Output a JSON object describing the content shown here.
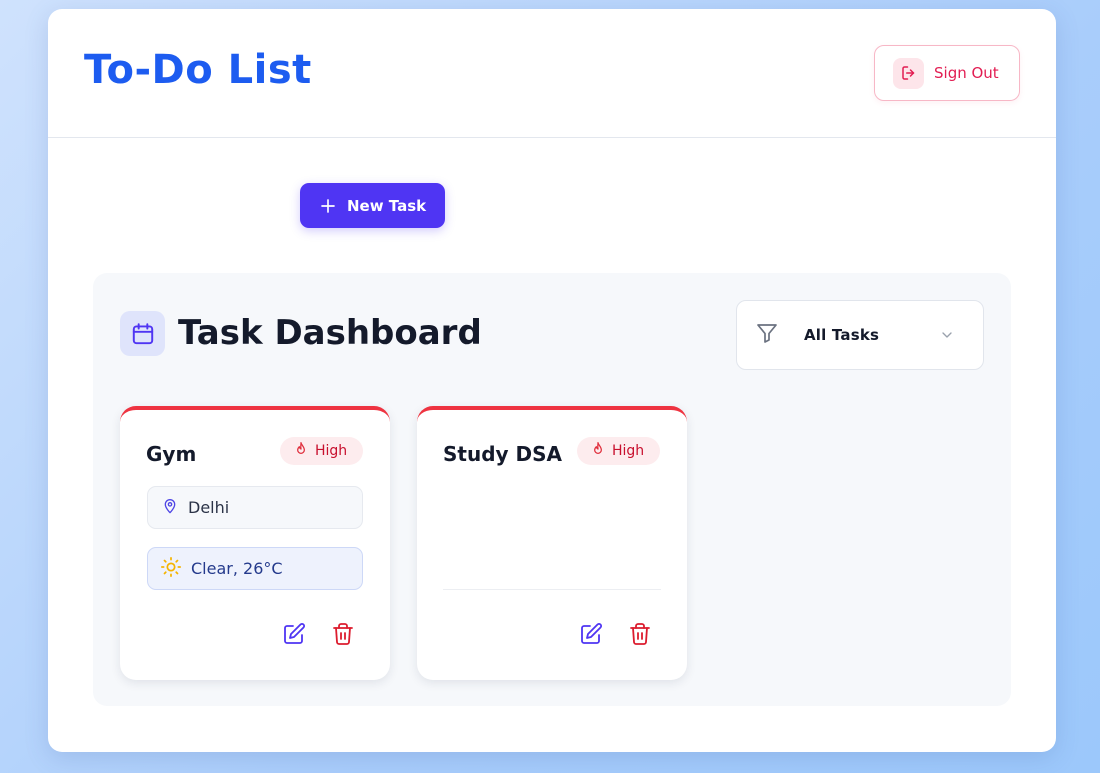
{
  "header": {
    "title": "To-Do List",
    "signout_label": "Sign Out"
  },
  "toolbar": {
    "new_task_label": "New Task"
  },
  "dashboard": {
    "title": "Task Dashboard",
    "filter": {
      "selected": "All Tasks"
    }
  },
  "tasks": [
    {
      "title": "Gym",
      "priority": "High",
      "location": "Delhi",
      "weather": "Clear, 26°C"
    },
    {
      "title": "Study DSA",
      "priority": "High"
    }
  ],
  "colors": {
    "brand_blue": "#1d5cf0",
    "primary_button": "#4f35f3",
    "danger": "#e21d52",
    "priority_high": "#ee3340"
  }
}
